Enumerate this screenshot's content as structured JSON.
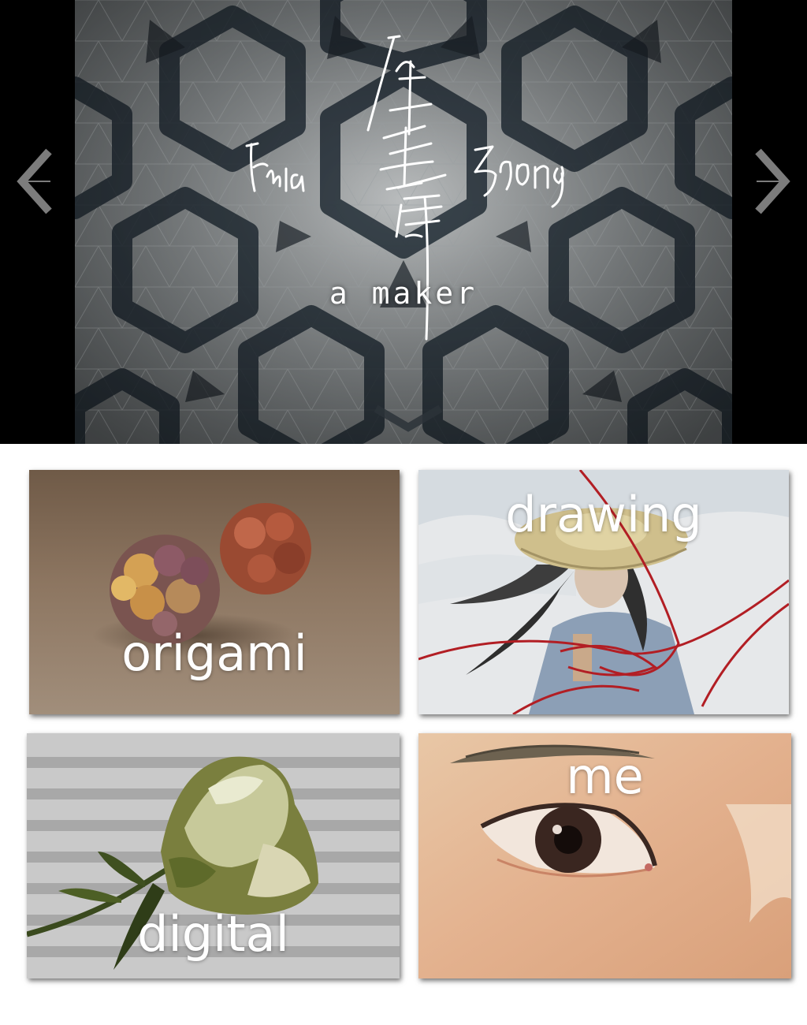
{
  "hero": {
    "signature": {
      "first_name": "Emla",
      "chinese_name": "钟天睿",
      "last_name": "Zhong"
    },
    "tagline": "a maker",
    "prev_icon": "chevron-left-icon",
    "next_icon": "chevron-right-icon",
    "scroll_icon": "chevron-down-icon"
  },
  "tiles": [
    {
      "label": "origami",
      "image": "origami-flower-balls"
    },
    {
      "label": "drawing",
      "image": "watercolor-girl-with-straw-hat"
    },
    {
      "label": "digital",
      "image": "white-rose-photo"
    },
    {
      "label": "me",
      "image": "watercolor-eye-portrait"
    }
  ],
  "colors": {
    "page_background": "#ffffff",
    "slider_side_bars": "#000000",
    "label_text": "#ffffff"
  }
}
